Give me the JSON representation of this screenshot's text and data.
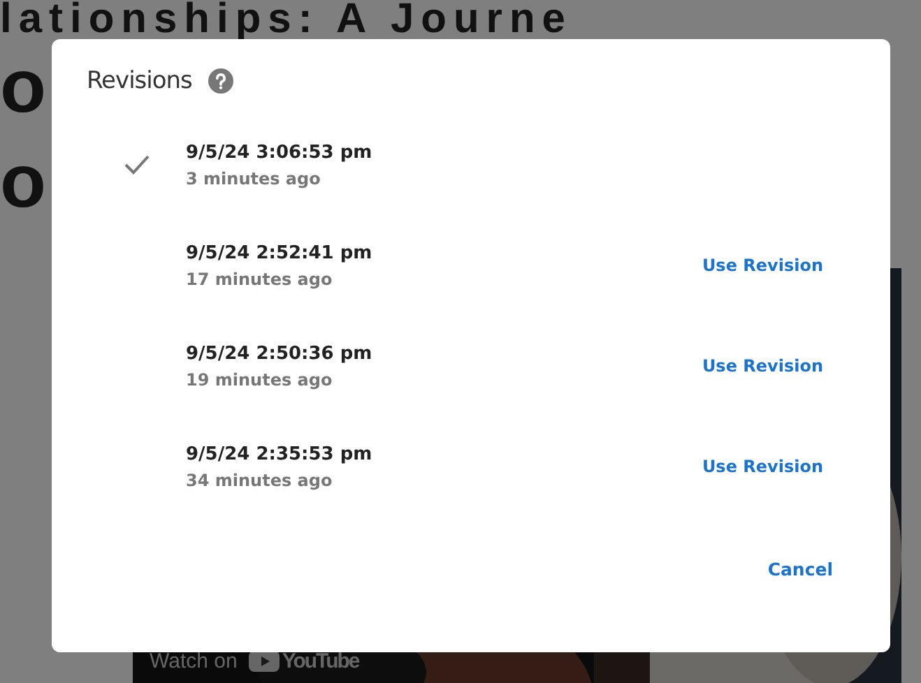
{
  "page": {
    "heading_lines": [
      "lationships: A Journe",
      "o",
      "o"
    ],
    "video": {
      "kind": "picture",
      "watch_label": "Watch on",
      "brand": "YouTube"
    }
  },
  "dialog": {
    "title": "Revisions",
    "revisions": [
      {
        "date": "9/5/24 3:06:53 pm",
        "ago": "3 minutes ago",
        "selected": true
      },
      {
        "date": "9/5/24 2:52:41 pm",
        "ago": "17 minutes ago",
        "selected": false,
        "action": "Use Revision"
      },
      {
        "date": "9/5/24 2:50:36 pm",
        "ago": "19 minutes ago",
        "selected": false,
        "action": "Use Revision"
      },
      {
        "date": "9/5/24 2:35:53 pm",
        "ago": "34 minutes ago",
        "selected": false,
        "action": "Use Revision"
      }
    ],
    "cancel": "Cancel"
  }
}
